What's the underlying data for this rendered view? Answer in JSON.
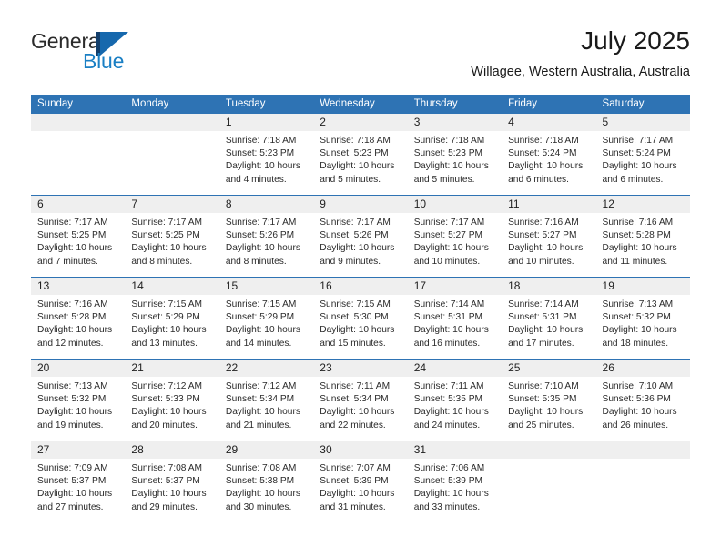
{
  "brand": {
    "name_part1": "General",
    "name_part2": "Blue",
    "mark": "triangle-flag-logo",
    "color_dark": "#123e6b",
    "color_blue": "#1668ad",
    "color_text_blue": "#1a7fc4"
  },
  "header": {
    "title": "July 2025",
    "subtitle": "Willagee, Western Australia, Australia"
  },
  "theme": {
    "header_blue": "#2e73b4",
    "date_band_gray": "#efefef",
    "text": "#2a2a2a"
  },
  "weekdays": [
    "Sunday",
    "Monday",
    "Tuesday",
    "Wednesday",
    "Thursday",
    "Friday",
    "Saturday"
  ],
  "weeks": [
    {
      "days": [
        {
          "num": "",
          "sunrise": "",
          "sunset": "",
          "daylight_l1": "",
          "daylight_l2": ""
        },
        {
          "num": "",
          "sunrise": "",
          "sunset": "",
          "daylight_l1": "",
          "daylight_l2": ""
        },
        {
          "num": "1",
          "sunrise": "Sunrise: 7:18 AM",
          "sunset": "Sunset: 5:23 PM",
          "daylight_l1": "Daylight: 10 hours",
          "daylight_l2": "and 4 minutes."
        },
        {
          "num": "2",
          "sunrise": "Sunrise: 7:18 AM",
          "sunset": "Sunset: 5:23 PM",
          "daylight_l1": "Daylight: 10 hours",
          "daylight_l2": "and 5 minutes."
        },
        {
          "num": "3",
          "sunrise": "Sunrise: 7:18 AM",
          "sunset": "Sunset: 5:23 PM",
          "daylight_l1": "Daylight: 10 hours",
          "daylight_l2": "and 5 minutes."
        },
        {
          "num": "4",
          "sunrise": "Sunrise: 7:18 AM",
          "sunset": "Sunset: 5:24 PM",
          "daylight_l1": "Daylight: 10 hours",
          "daylight_l2": "and 6 minutes."
        },
        {
          "num": "5",
          "sunrise": "Sunrise: 7:17 AM",
          "sunset": "Sunset: 5:24 PM",
          "daylight_l1": "Daylight: 10 hours",
          "daylight_l2": "and 6 minutes."
        }
      ]
    },
    {
      "days": [
        {
          "num": "6",
          "sunrise": "Sunrise: 7:17 AM",
          "sunset": "Sunset: 5:25 PM",
          "daylight_l1": "Daylight: 10 hours",
          "daylight_l2": "and 7 minutes."
        },
        {
          "num": "7",
          "sunrise": "Sunrise: 7:17 AM",
          "sunset": "Sunset: 5:25 PM",
          "daylight_l1": "Daylight: 10 hours",
          "daylight_l2": "and 8 minutes."
        },
        {
          "num": "8",
          "sunrise": "Sunrise: 7:17 AM",
          "sunset": "Sunset: 5:26 PM",
          "daylight_l1": "Daylight: 10 hours",
          "daylight_l2": "and 8 minutes."
        },
        {
          "num": "9",
          "sunrise": "Sunrise: 7:17 AM",
          "sunset": "Sunset: 5:26 PM",
          "daylight_l1": "Daylight: 10 hours",
          "daylight_l2": "and 9 minutes."
        },
        {
          "num": "10",
          "sunrise": "Sunrise: 7:17 AM",
          "sunset": "Sunset: 5:27 PM",
          "daylight_l1": "Daylight: 10 hours",
          "daylight_l2": "and 10 minutes."
        },
        {
          "num": "11",
          "sunrise": "Sunrise: 7:16 AM",
          "sunset": "Sunset: 5:27 PM",
          "daylight_l1": "Daylight: 10 hours",
          "daylight_l2": "and 10 minutes."
        },
        {
          "num": "12",
          "sunrise": "Sunrise: 7:16 AM",
          "sunset": "Sunset: 5:28 PM",
          "daylight_l1": "Daylight: 10 hours",
          "daylight_l2": "and 11 minutes."
        }
      ]
    },
    {
      "days": [
        {
          "num": "13",
          "sunrise": "Sunrise: 7:16 AM",
          "sunset": "Sunset: 5:28 PM",
          "daylight_l1": "Daylight: 10 hours",
          "daylight_l2": "and 12 minutes."
        },
        {
          "num": "14",
          "sunrise": "Sunrise: 7:15 AM",
          "sunset": "Sunset: 5:29 PM",
          "daylight_l1": "Daylight: 10 hours",
          "daylight_l2": "and 13 minutes."
        },
        {
          "num": "15",
          "sunrise": "Sunrise: 7:15 AM",
          "sunset": "Sunset: 5:29 PM",
          "daylight_l1": "Daylight: 10 hours",
          "daylight_l2": "and 14 minutes."
        },
        {
          "num": "16",
          "sunrise": "Sunrise: 7:15 AM",
          "sunset": "Sunset: 5:30 PM",
          "daylight_l1": "Daylight: 10 hours",
          "daylight_l2": "and 15 minutes."
        },
        {
          "num": "17",
          "sunrise": "Sunrise: 7:14 AM",
          "sunset": "Sunset: 5:31 PM",
          "daylight_l1": "Daylight: 10 hours",
          "daylight_l2": "and 16 minutes."
        },
        {
          "num": "18",
          "sunrise": "Sunrise: 7:14 AM",
          "sunset": "Sunset: 5:31 PM",
          "daylight_l1": "Daylight: 10 hours",
          "daylight_l2": "and 17 minutes."
        },
        {
          "num": "19",
          "sunrise": "Sunrise: 7:13 AM",
          "sunset": "Sunset: 5:32 PM",
          "daylight_l1": "Daylight: 10 hours",
          "daylight_l2": "and 18 minutes."
        }
      ]
    },
    {
      "days": [
        {
          "num": "20",
          "sunrise": "Sunrise: 7:13 AM",
          "sunset": "Sunset: 5:32 PM",
          "daylight_l1": "Daylight: 10 hours",
          "daylight_l2": "and 19 minutes."
        },
        {
          "num": "21",
          "sunrise": "Sunrise: 7:12 AM",
          "sunset": "Sunset: 5:33 PM",
          "daylight_l1": "Daylight: 10 hours",
          "daylight_l2": "and 20 minutes."
        },
        {
          "num": "22",
          "sunrise": "Sunrise: 7:12 AM",
          "sunset": "Sunset: 5:34 PM",
          "daylight_l1": "Daylight: 10 hours",
          "daylight_l2": "and 21 minutes."
        },
        {
          "num": "23",
          "sunrise": "Sunrise: 7:11 AM",
          "sunset": "Sunset: 5:34 PM",
          "daylight_l1": "Daylight: 10 hours",
          "daylight_l2": "and 22 minutes."
        },
        {
          "num": "24",
          "sunrise": "Sunrise: 7:11 AM",
          "sunset": "Sunset: 5:35 PM",
          "daylight_l1": "Daylight: 10 hours",
          "daylight_l2": "and 24 minutes."
        },
        {
          "num": "25",
          "sunrise": "Sunrise: 7:10 AM",
          "sunset": "Sunset: 5:35 PM",
          "daylight_l1": "Daylight: 10 hours",
          "daylight_l2": "and 25 minutes."
        },
        {
          "num": "26",
          "sunrise": "Sunrise: 7:10 AM",
          "sunset": "Sunset: 5:36 PM",
          "daylight_l1": "Daylight: 10 hours",
          "daylight_l2": "and 26 minutes."
        }
      ]
    },
    {
      "days": [
        {
          "num": "27",
          "sunrise": "Sunrise: 7:09 AM",
          "sunset": "Sunset: 5:37 PM",
          "daylight_l1": "Daylight: 10 hours",
          "daylight_l2": "and 27 minutes."
        },
        {
          "num": "28",
          "sunrise": "Sunrise: 7:08 AM",
          "sunset": "Sunset: 5:37 PM",
          "daylight_l1": "Daylight: 10 hours",
          "daylight_l2": "and 29 minutes."
        },
        {
          "num": "29",
          "sunrise": "Sunrise: 7:08 AM",
          "sunset": "Sunset: 5:38 PM",
          "daylight_l1": "Daylight: 10 hours",
          "daylight_l2": "and 30 minutes."
        },
        {
          "num": "30",
          "sunrise": "Sunrise: 7:07 AM",
          "sunset": "Sunset: 5:39 PM",
          "daylight_l1": "Daylight: 10 hours",
          "daylight_l2": "and 31 minutes."
        },
        {
          "num": "31",
          "sunrise": "Sunrise: 7:06 AM",
          "sunset": "Sunset: 5:39 PM",
          "daylight_l1": "Daylight: 10 hours",
          "daylight_l2": "and 33 minutes."
        },
        {
          "num": "",
          "sunrise": "",
          "sunset": "",
          "daylight_l1": "",
          "daylight_l2": ""
        },
        {
          "num": "",
          "sunrise": "",
          "sunset": "",
          "daylight_l1": "",
          "daylight_l2": ""
        }
      ]
    }
  ]
}
